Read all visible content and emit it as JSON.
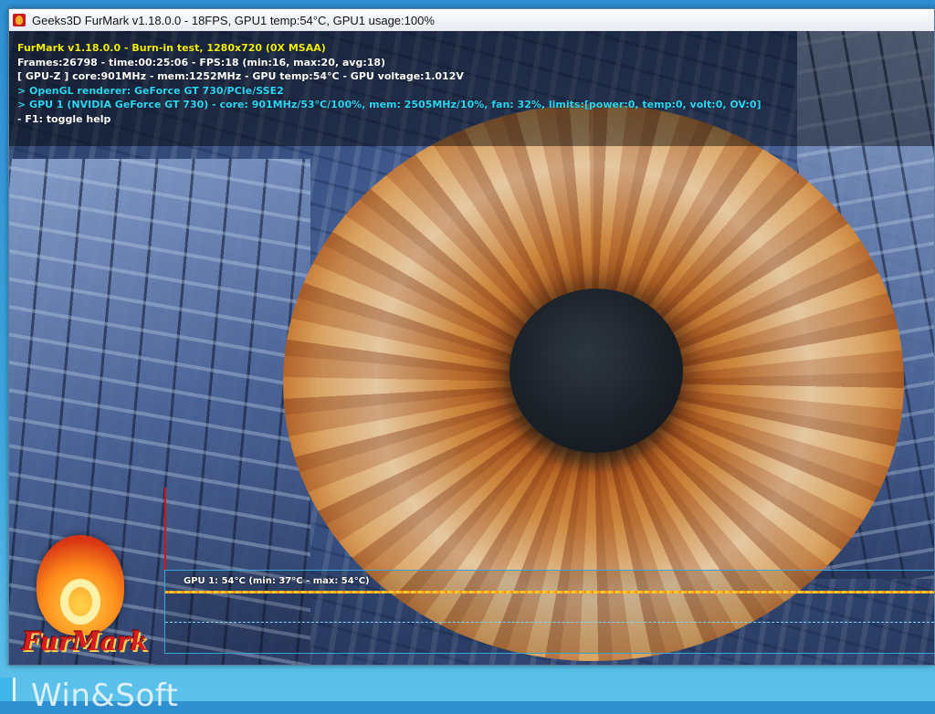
{
  "window": {
    "title": "Geeks3D FurMark v1.18.0.0 - 18FPS, GPU1 temp:54°C, GPU1 usage:100%"
  },
  "osd": {
    "line1": "FurMark v1.18.0.0 - Burn-in test, 1280x720 (0X MSAA)",
    "line2": "Frames:26798 - time:00:25:06 - FPS:18 (min:16, max:20, avg:18)",
    "line3": "[ GPU-Z ] core:901MHz - mem:1252MHz - GPU temp:54°C - GPU voltage:1.012V",
    "line4": "> OpenGL renderer: GeForce GT 730/PCIe/SSE2",
    "line5": "> GPU 1 (NVIDIA GeForce GT 730) - core: 901MHz/53°C/100%, mem: 2505MHz/10%, fan: 32%, limits:[power:0, temp:0, volt:0, OV:0]",
    "line6": "- F1: toggle help"
  },
  "graph": {
    "label": "GPU 1: 54°C (min: 37°C - max: 54°C)",
    "current_temp_c": 54,
    "min_temp_c": 37,
    "max_temp_c": 54
  },
  "logo": {
    "text": "FurMark"
  },
  "desktop": {
    "watermark": "Win&Soft"
  },
  "colors": {
    "osd_title": "#f2f200",
    "osd_text": "#ffffff",
    "osd_info": "#2bd8f6",
    "graph_line": "#ffb31f",
    "graph_border": "#3aa3d6"
  }
}
